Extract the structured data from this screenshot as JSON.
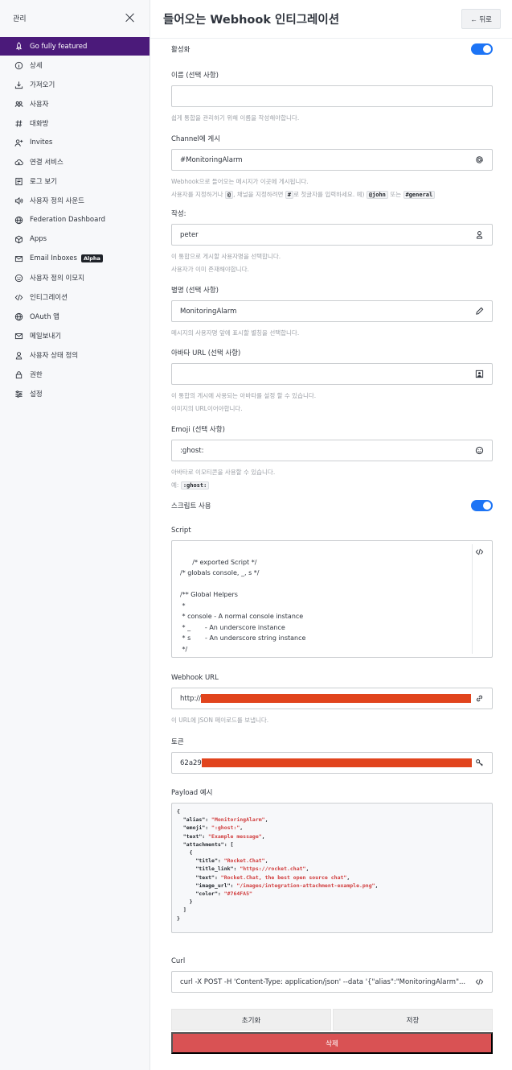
{
  "sidebar": {
    "title": "관리",
    "items": [
      {
        "label": "Go fully featured",
        "icon": "rocket-icon",
        "active": true
      },
      {
        "label": "상세",
        "icon": "info-icon"
      },
      {
        "label": "가져오기",
        "icon": "import-icon"
      },
      {
        "label": "사용자",
        "icon": "team-icon"
      },
      {
        "label": "대화방",
        "icon": "hashtag-icon"
      },
      {
        "label": "Invites",
        "icon": "user-plus-icon"
      },
      {
        "label": "연결 서비스",
        "icon": "cloud-icon"
      },
      {
        "label": "로그 보기",
        "icon": "log-icon"
      },
      {
        "label": "사용자 정의 사운드",
        "icon": "volume-icon"
      },
      {
        "label": "Federation Dashboard",
        "icon": "globe-icon"
      },
      {
        "label": "Apps",
        "icon": "cube-icon"
      },
      {
        "label": "Email Inboxes",
        "icon": "mail-icon",
        "badge": "Alpha"
      },
      {
        "label": "사용자 정의 이모지",
        "icon": "emoji-icon"
      },
      {
        "label": "인티그레이션",
        "icon": "code-icon"
      },
      {
        "label": "OAuth 앱",
        "icon": "globe-icon"
      },
      {
        "label": "메일보내기",
        "icon": "mail-icon"
      },
      {
        "label": "사용자 상태 정의",
        "icon": "user-icon"
      },
      {
        "label": "권한",
        "icon": "lock-icon"
      },
      {
        "label": "설정",
        "icon": "sliders-icon"
      }
    ]
  },
  "header": {
    "title": "들어오는 Webhook 인티그레이션",
    "back_label": "← 뒤로"
  },
  "form": {
    "enabled_label": "활성화",
    "name": {
      "label": "이름 (선택 사항)",
      "value": "",
      "hint": "쉽게 통합을 관리하기 위해 이름을 작성해야합니다."
    },
    "channel": {
      "label": "Channel에 게시",
      "value": "#MonitoringAlarm",
      "hint1": "Webhook으로 들어오는 메시지가 이곳에 게시됩니다.",
      "hint2_a": "사용자를 지정하거나",
      "hint2_code1": "@",
      "hint2_b": ", 채널을 지정하려면",
      "hint2_code2": "#",
      "hint2_c": "로 첫글자를 입력하세요. 예)",
      "hint2_code3": "@john",
      "hint2_d": "또는",
      "hint2_code4": "#general"
    },
    "author": {
      "label": "작성:",
      "value": "peter",
      "hint1": "이 통합으로 게시할 사용자명을 선택합니다.",
      "hint2": "사용자가 이미 존재해야합니다."
    },
    "alias": {
      "label": "별명 (선택 사항)",
      "value": "MonitoringAlarm",
      "hint": "메시지의 사용자명 앞에 표시할 별칭을 선택합니다."
    },
    "avatar": {
      "label": "아바타 URL (선택 사항)",
      "value": "",
      "hint1": "이 통합의 게시에 사용되는 아바타를 설정 할 수 있습니다.",
      "hint2": "이미지의 URL이어야합니다."
    },
    "emoji": {
      "label": "Emoji (선택 사항)",
      "value": ":ghost:",
      "hint1": "아바타로 이모티콘을 사용할 수 있습니다.",
      "hint2_a": "예:",
      "hint2_code": ":ghost:"
    },
    "script_enabled_label": "스크립트 사용",
    "script": {
      "label": "Script",
      "value": "/* exported Script */\n/* globals console, _, s */\n\n/** Global Helpers\n *\n * console - A normal console instance\n * _       - An underscore instance\n * s       - An underscore string instance\n */"
    },
    "webhook_url": {
      "label": "Webhook URL",
      "value": "http://",
      "hint": "이 URL에 JSON 페이로드를 보냅니다."
    },
    "token": {
      "label": "토큰",
      "value": "62a29"
    },
    "payload": {
      "label": "Payload 예시"
    },
    "curl": {
      "label": "Curl",
      "value": "curl -X POST -H 'Content-Type: application/json' --data '{\"alias\":\"MonitoringAlarm\"..."
    },
    "reset_label": "초기화",
    "save_label": "저장",
    "delete_label": "삭제"
  },
  "payload_lines": [
    {
      "t": "{"
    },
    {
      "t": "  \"alias\": ",
      "s": "\"MonitoringAlarm\"",
      "e": ","
    },
    {
      "t": "  \"emoji\": ",
      "s": "\":ghost:\"",
      "e": ","
    },
    {
      "t": "  \"text\": ",
      "s": "\"Example message\"",
      "e": ","
    },
    {
      "t": "  \"attachments\": ["
    },
    {
      "t": "    {"
    },
    {
      "t": "      \"title\": ",
      "s": "\"Rocket.Chat\"",
      "e": ","
    },
    {
      "t": "      \"title_link\": ",
      "s": "\"https://rocket.chat\"",
      "e": ","
    },
    {
      "t": "      \"text\": ",
      "s": "\"Rocket.Chat, the best open source chat\"",
      "e": ","
    },
    {
      "t": "      \"image_url\": ",
      "s": "\"/images/integration-attachment-example.png\"",
      "e": ","
    },
    {
      "t": "      \"color\": ",
      "s": "\"#764FA5\""
    },
    {
      "t": "    }"
    },
    {
      "t": "  ]"
    },
    {
      "t": "}"
    }
  ],
  "colors": {
    "accent": "#1d74f5",
    "brand": "#4b1a7a",
    "danger": "#d95254",
    "redaction": "#e1441d"
  }
}
